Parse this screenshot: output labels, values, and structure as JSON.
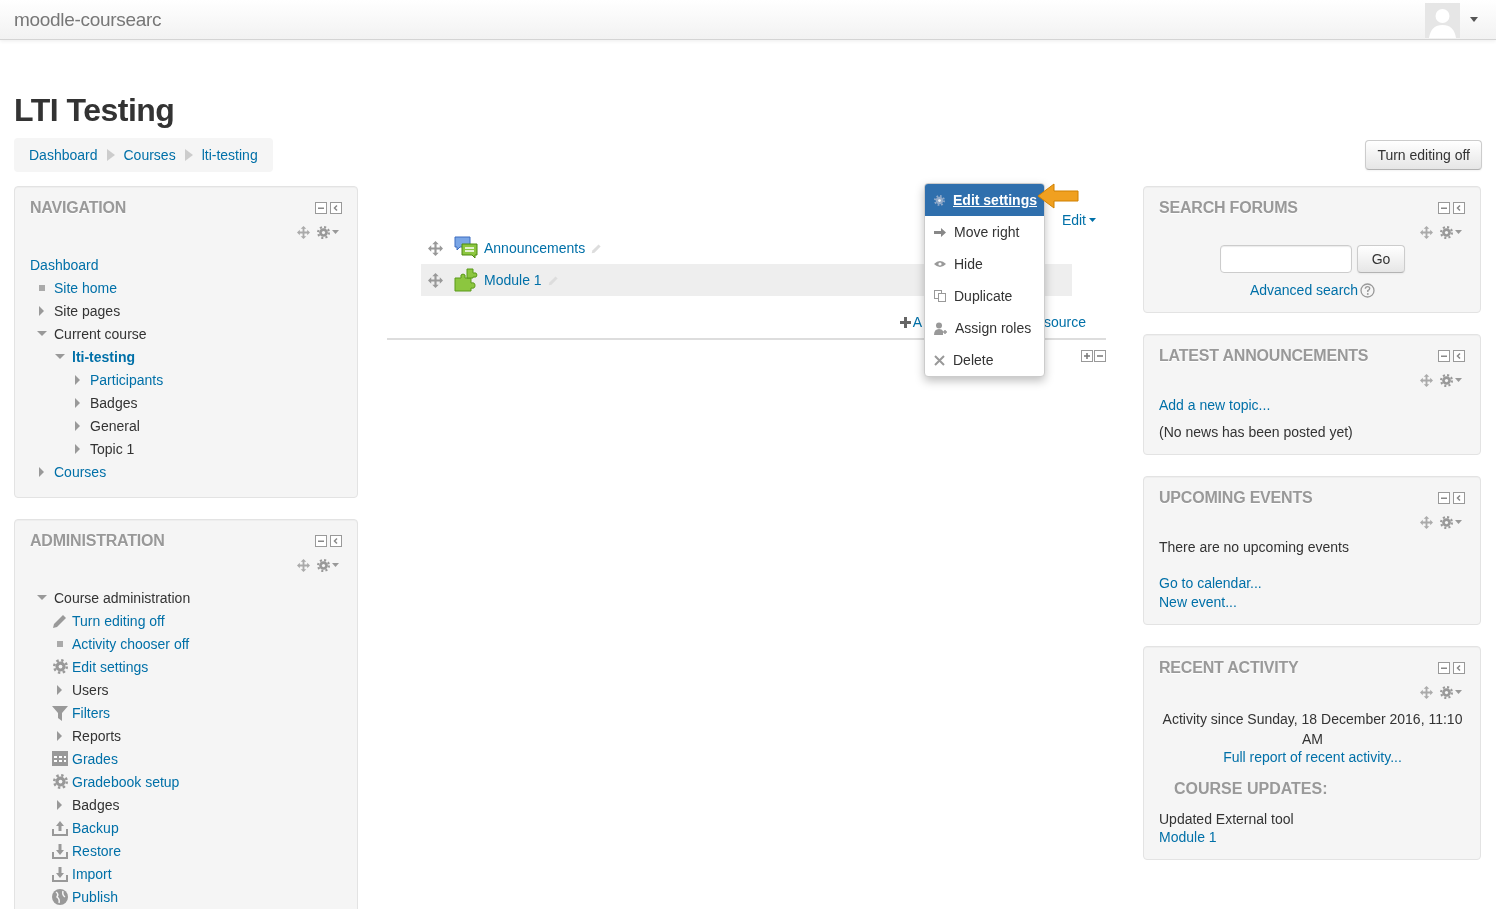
{
  "header": {
    "site_name": "moodle-coursearc"
  },
  "page_title": "LTI Testing",
  "breadcrumb": [
    {
      "label": "Dashboard"
    },
    {
      "label": "Courses"
    },
    {
      "label": "lti-testing"
    }
  ],
  "edit_mode_button": "Turn editing off",
  "navigation": {
    "title": "NAVIGATION",
    "items": [
      {
        "label": "Dashboard",
        "link": true,
        "current": false,
        "children": [
          {
            "label": "Site home",
            "kind": "leaf",
            "link": true,
            "current": false
          },
          {
            "label": "Site pages",
            "kind": "branch",
            "expanded": false,
            "link": false,
            "current": false
          },
          {
            "label": "Current course",
            "kind": "branch",
            "expanded": true,
            "link": false,
            "current": false,
            "children": [
              {
                "label": "lti-testing",
                "kind": "branch",
                "expanded": true,
                "link": true,
                "current": true,
                "children": [
                  {
                    "label": "Participants",
                    "kind": "branch",
                    "expanded": false,
                    "link": true,
                    "current": false
                  },
                  {
                    "label": "Badges",
                    "kind": "branch",
                    "expanded": false,
                    "link": false,
                    "current": false
                  },
                  {
                    "label": "General",
                    "kind": "branch",
                    "expanded": false,
                    "link": false,
                    "current": false
                  },
                  {
                    "label": "Topic 1",
                    "kind": "branch",
                    "expanded": false,
                    "link": false,
                    "current": false
                  }
                ]
              }
            ]
          },
          {
            "label": "Courses",
            "kind": "branch",
            "expanded": false,
            "link": true,
            "current": false
          }
        ]
      }
    ]
  },
  "administration": {
    "title": "ADMINISTRATION",
    "items": [
      {
        "label": "Course administration",
        "kind": "branch",
        "expanded": true,
        "link": false,
        "current": false,
        "children": [
          {
            "label": "Turn editing off",
            "kind": "edit",
            "link": true,
            "current": false
          },
          {
            "label": "Activity chooser off",
            "kind": "leaf",
            "link": true,
            "current": false
          },
          {
            "label": "Edit settings",
            "kind": "settings",
            "link": true,
            "current": false
          },
          {
            "label": "Users",
            "kind": "branch",
            "expanded": false,
            "link": false,
            "current": false
          },
          {
            "label": "Filters",
            "kind": "filter",
            "link": true,
            "current": false
          },
          {
            "label": "Reports",
            "kind": "branch",
            "expanded": false,
            "link": false,
            "current": false
          },
          {
            "label": "Grades",
            "kind": "table",
            "link": true,
            "current": false
          },
          {
            "label": "Gradebook setup",
            "kind": "settings",
            "link": true,
            "current": false
          },
          {
            "label": "Badges",
            "kind": "branch",
            "expanded": false,
            "link": false,
            "current": false
          },
          {
            "label": "Backup",
            "kind": "backup",
            "link": true,
            "current": false
          },
          {
            "label": "Restore",
            "kind": "restore",
            "link": true,
            "current": false
          },
          {
            "label": "Import",
            "kind": "import",
            "link": true,
            "current": false
          },
          {
            "label": "Publish",
            "kind": "publish",
            "link": true,
            "current": false
          }
        ]
      }
    ]
  },
  "section": {
    "edit_link": "Edit",
    "activities": [
      {
        "name": "Announcements",
        "kind": "forum",
        "highlighted": false
      },
      {
        "name": "Module 1",
        "kind": "lti",
        "highlighted": true
      }
    ],
    "add_link": {
      "start": "A",
      "end": "source"
    },
    "menu": [
      {
        "label": "Edit settings",
        "kind": "settings",
        "selected": true
      },
      {
        "label": "Move right",
        "kind": "move-right",
        "selected": false
      },
      {
        "label": "Hide",
        "kind": "hide",
        "selected": false
      },
      {
        "label": "Duplicate",
        "kind": "duplicate",
        "selected": false
      },
      {
        "label": "Assign roles",
        "kind": "roles",
        "selected": false
      },
      {
        "label": "Delete",
        "kind": "delete",
        "selected": false
      }
    ]
  },
  "blocks": [
    {
      "kind": "search",
      "title": "SEARCH FORUMS",
      "button": "Go",
      "link": "Advanced search"
    },
    {
      "kind": "news",
      "title": "LATEST ANNOUNCEMENTS",
      "link": "Add a new topic...",
      "message": "(No news has been posted yet)"
    },
    {
      "kind": "events",
      "title": "UPCOMING EVENTS",
      "message": "There are no upcoming events",
      "links": [
        "Go to calendar...",
        "New event..."
      ]
    },
    {
      "kind": "recent",
      "title": "RECENT ACTIVITY",
      "since": "Activity since Sunday, 18 December 2016, 11:10 AM",
      "link": "Full report of recent activity...",
      "subheading": "COURSE UPDATES:",
      "update": "Updated External tool",
      "update_link": "Module 1"
    }
  ]
}
